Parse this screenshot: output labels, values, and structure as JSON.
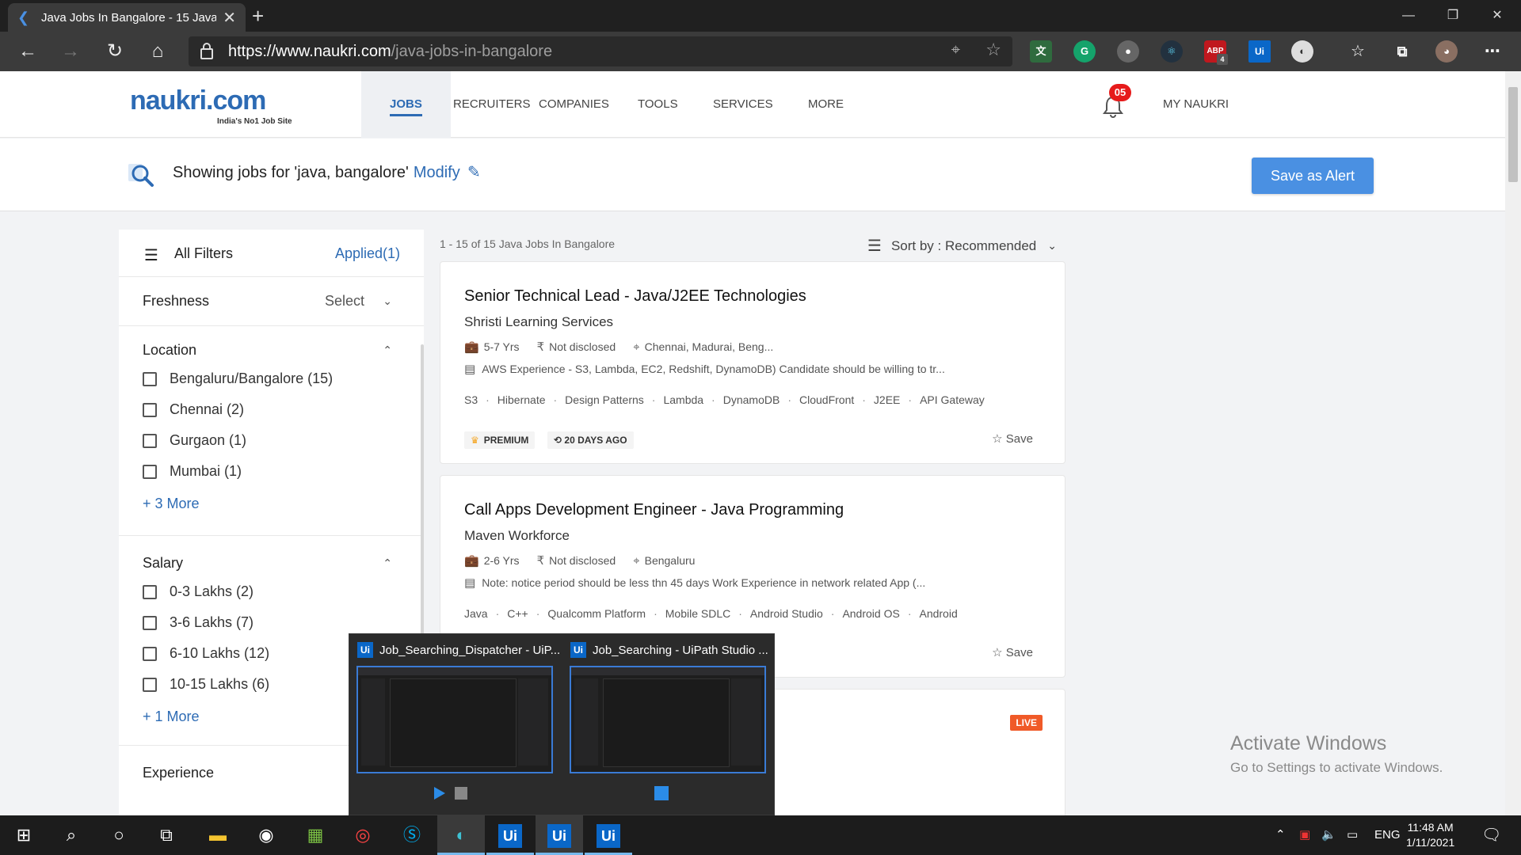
{
  "browser": {
    "tab_title": "Java Jobs In Bangalore - 15 Java",
    "url_domain": "https://www.naukri.com",
    "url_path": "/java-jobs-in-bangalore",
    "ext_abp_count": "4"
  },
  "header": {
    "logo_text": "naukri.com",
    "logo_tagline": "India's No1 Job Site",
    "nav": [
      "JOBS",
      "RECRUITERS",
      "COMPANIES",
      "TOOLS",
      "SERVICES",
      "MORE"
    ],
    "notification_count": "05",
    "my_naukri": "MY NAUKRI"
  },
  "search": {
    "showing": "Showing jobs for 'java, bangalore'",
    "modify": "Modify",
    "save_alert": "Save as Alert"
  },
  "filters": {
    "title": "All Filters",
    "applied": "Applied(1)",
    "freshness": {
      "title": "Freshness",
      "select": "Select"
    },
    "location": {
      "title": "Location",
      "options": [
        "Bengaluru/Bangalore (15)",
        "Chennai (2)",
        "Gurgaon (1)",
        "Mumbai (1)"
      ],
      "more": "+ 3 More"
    },
    "salary": {
      "title": "Salary",
      "options": [
        "0-3 Lakhs (2)",
        "3-6 Lakhs (7)",
        "6-10 Lakhs (12)",
        "10-15 Lakhs (6)"
      ],
      "more": "+ 1 More"
    },
    "experience": {
      "title": "Experience"
    }
  },
  "results": {
    "count": "1 - 15 of 15  Java Jobs In Bangalore",
    "sort": "Sort by : Recommended"
  },
  "jobs": [
    {
      "title": "Senior Technical Lead - Java/J2EE Technologies",
      "company": "Shristi Learning Services",
      "experience": "5-7 Yrs",
      "salary": "Not disclosed",
      "location": "Chennai, Madurai, Beng...",
      "description": "AWS Experience - S3, Lambda, EC2, Redshift, DynamoDB) Candidate should be willing to tr...",
      "tags": [
        "S3",
        "Hibernate",
        "Design Patterns",
        "Lambda",
        "DynamoDB",
        "CloudFront",
        "J2EE",
        "API Gateway"
      ],
      "badge_premium": "PREMIUM",
      "badge_age": "20 DAYS AGO",
      "save": "Save"
    },
    {
      "title": "Call Apps Development Engineer - Java Programming",
      "company": "Maven Workforce",
      "experience": "2-6 Yrs",
      "salary": "Not disclosed",
      "location": "Bengaluru",
      "description": "Note: notice period should be less thn 45 days Work Experience in network related App (...",
      "tags": [
        "Java",
        "C++",
        "Qualcomm Platform",
        "Mobile SDLC",
        "Android Studio",
        "Android OS",
        "Android"
      ],
      "save": "Save"
    },
    {
      "live": "LIVE"
    }
  ],
  "activate_windows": {
    "line1": "Activate Windows",
    "line2": "Go to Settings to activate Windows."
  },
  "thumbnails": [
    {
      "title": "Job_Searching_Dispatcher - UiP...",
      "icon": "Ui"
    },
    {
      "title": "Job_Searching - UiPath Studio ...",
      "icon": "Ui"
    }
  ],
  "taskbar": {
    "lang": "ENG",
    "time": "11:48 AM",
    "date": "1/11/2021",
    "ui_label": "Ui"
  }
}
